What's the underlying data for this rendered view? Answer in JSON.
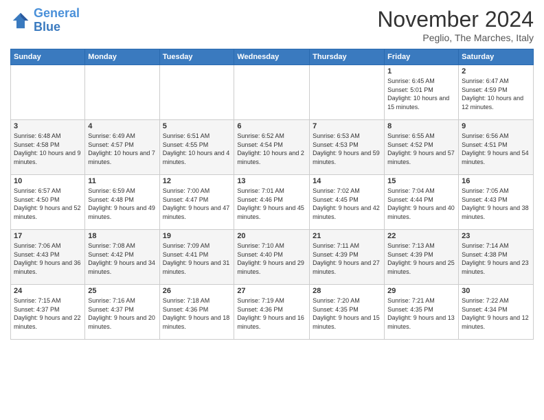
{
  "logo": {
    "line1": "General",
    "line2": "Blue"
  },
  "title": "November 2024",
  "subtitle": "Peglio, The Marches, Italy",
  "days_of_week": [
    "Sunday",
    "Monday",
    "Tuesday",
    "Wednesday",
    "Thursday",
    "Friday",
    "Saturday"
  ],
  "weeks": [
    [
      {
        "day": "",
        "info": ""
      },
      {
        "day": "",
        "info": ""
      },
      {
        "day": "",
        "info": ""
      },
      {
        "day": "",
        "info": ""
      },
      {
        "day": "",
        "info": ""
      },
      {
        "day": "1",
        "info": "Sunrise: 6:45 AM\nSunset: 5:01 PM\nDaylight: 10 hours and 15 minutes."
      },
      {
        "day": "2",
        "info": "Sunrise: 6:47 AM\nSunset: 4:59 PM\nDaylight: 10 hours and 12 minutes."
      }
    ],
    [
      {
        "day": "3",
        "info": "Sunrise: 6:48 AM\nSunset: 4:58 PM\nDaylight: 10 hours and 9 minutes."
      },
      {
        "day": "4",
        "info": "Sunrise: 6:49 AM\nSunset: 4:57 PM\nDaylight: 10 hours and 7 minutes."
      },
      {
        "day": "5",
        "info": "Sunrise: 6:51 AM\nSunset: 4:55 PM\nDaylight: 10 hours and 4 minutes."
      },
      {
        "day": "6",
        "info": "Sunrise: 6:52 AM\nSunset: 4:54 PM\nDaylight: 10 hours and 2 minutes."
      },
      {
        "day": "7",
        "info": "Sunrise: 6:53 AM\nSunset: 4:53 PM\nDaylight: 9 hours and 59 minutes."
      },
      {
        "day": "8",
        "info": "Sunrise: 6:55 AM\nSunset: 4:52 PM\nDaylight: 9 hours and 57 minutes."
      },
      {
        "day": "9",
        "info": "Sunrise: 6:56 AM\nSunset: 4:51 PM\nDaylight: 9 hours and 54 minutes."
      }
    ],
    [
      {
        "day": "10",
        "info": "Sunrise: 6:57 AM\nSunset: 4:50 PM\nDaylight: 9 hours and 52 minutes."
      },
      {
        "day": "11",
        "info": "Sunrise: 6:59 AM\nSunset: 4:48 PM\nDaylight: 9 hours and 49 minutes."
      },
      {
        "day": "12",
        "info": "Sunrise: 7:00 AM\nSunset: 4:47 PM\nDaylight: 9 hours and 47 minutes."
      },
      {
        "day": "13",
        "info": "Sunrise: 7:01 AM\nSunset: 4:46 PM\nDaylight: 9 hours and 45 minutes."
      },
      {
        "day": "14",
        "info": "Sunrise: 7:02 AM\nSunset: 4:45 PM\nDaylight: 9 hours and 42 minutes."
      },
      {
        "day": "15",
        "info": "Sunrise: 7:04 AM\nSunset: 4:44 PM\nDaylight: 9 hours and 40 minutes."
      },
      {
        "day": "16",
        "info": "Sunrise: 7:05 AM\nSunset: 4:43 PM\nDaylight: 9 hours and 38 minutes."
      }
    ],
    [
      {
        "day": "17",
        "info": "Sunrise: 7:06 AM\nSunset: 4:43 PM\nDaylight: 9 hours and 36 minutes."
      },
      {
        "day": "18",
        "info": "Sunrise: 7:08 AM\nSunset: 4:42 PM\nDaylight: 9 hours and 34 minutes."
      },
      {
        "day": "19",
        "info": "Sunrise: 7:09 AM\nSunset: 4:41 PM\nDaylight: 9 hours and 31 minutes."
      },
      {
        "day": "20",
        "info": "Sunrise: 7:10 AM\nSunset: 4:40 PM\nDaylight: 9 hours and 29 minutes."
      },
      {
        "day": "21",
        "info": "Sunrise: 7:11 AM\nSunset: 4:39 PM\nDaylight: 9 hours and 27 minutes."
      },
      {
        "day": "22",
        "info": "Sunrise: 7:13 AM\nSunset: 4:39 PM\nDaylight: 9 hours and 25 minutes."
      },
      {
        "day": "23",
        "info": "Sunrise: 7:14 AM\nSunset: 4:38 PM\nDaylight: 9 hours and 23 minutes."
      }
    ],
    [
      {
        "day": "24",
        "info": "Sunrise: 7:15 AM\nSunset: 4:37 PM\nDaylight: 9 hours and 22 minutes."
      },
      {
        "day": "25",
        "info": "Sunrise: 7:16 AM\nSunset: 4:37 PM\nDaylight: 9 hours and 20 minutes."
      },
      {
        "day": "26",
        "info": "Sunrise: 7:18 AM\nSunset: 4:36 PM\nDaylight: 9 hours and 18 minutes."
      },
      {
        "day": "27",
        "info": "Sunrise: 7:19 AM\nSunset: 4:36 PM\nDaylight: 9 hours and 16 minutes."
      },
      {
        "day": "28",
        "info": "Sunrise: 7:20 AM\nSunset: 4:35 PM\nDaylight: 9 hours and 15 minutes."
      },
      {
        "day": "29",
        "info": "Sunrise: 7:21 AM\nSunset: 4:35 PM\nDaylight: 9 hours and 13 minutes."
      },
      {
        "day": "30",
        "info": "Sunrise: 7:22 AM\nSunset: 4:34 PM\nDaylight: 9 hours and 12 minutes."
      }
    ]
  ]
}
